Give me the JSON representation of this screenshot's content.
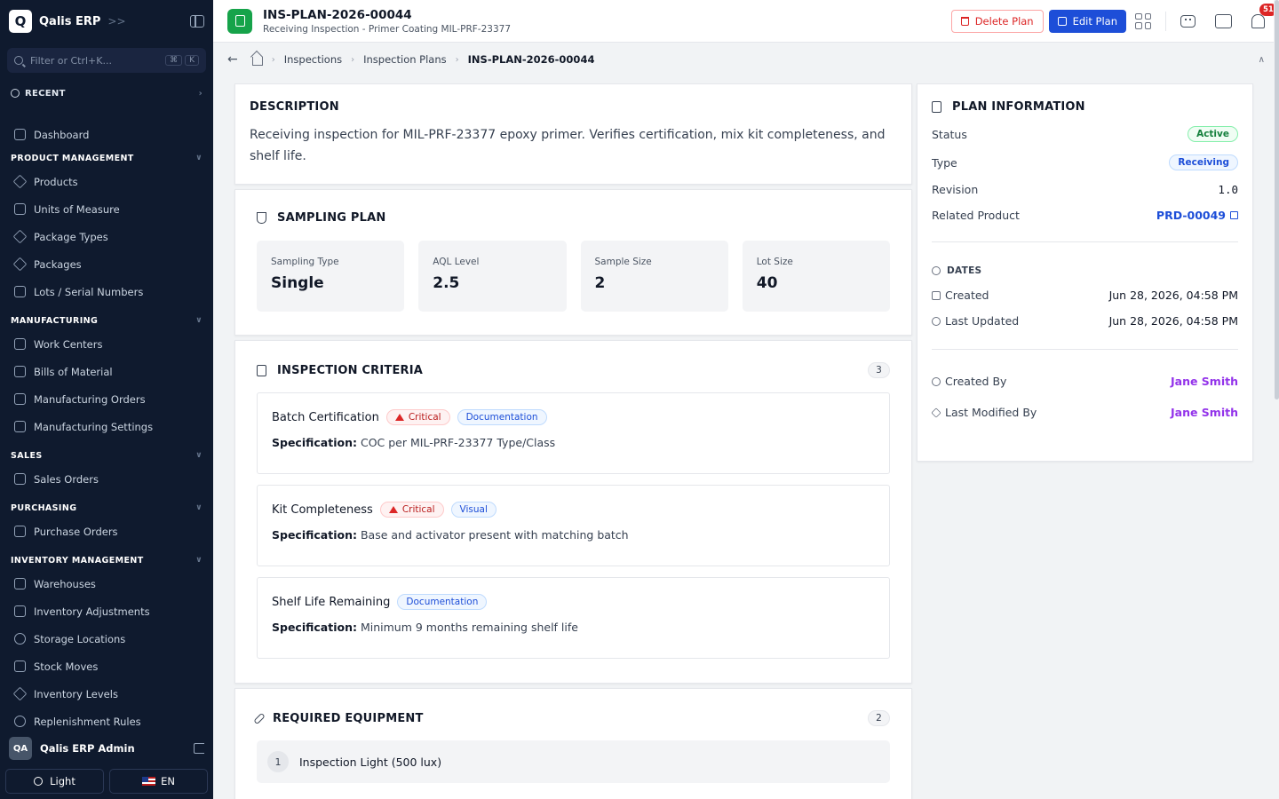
{
  "app": {
    "name": "Qalis ERP",
    "logo_letter": "Q"
  },
  "sidebar": {
    "search_placeholder": "Filter or Ctrl+K...",
    "shortcut_keys": [
      "⌘",
      "K"
    ],
    "recent_label": "RECENT",
    "dashboard": "Dashboard",
    "sections": [
      {
        "title": "PRODUCT MANAGEMENT",
        "items": [
          "Products",
          "Units of Measure",
          "Package Types",
          "Packages",
          "Lots / Serial Numbers"
        ]
      },
      {
        "title": "MANUFACTURING",
        "items": [
          "Work Centers",
          "Bills of Material",
          "Manufacturing Orders",
          "Manufacturing Settings"
        ]
      },
      {
        "title": "SALES",
        "items": [
          "Sales Orders"
        ]
      },
      {
        "title": "PURCHASING",
        "items": [
          "Purchase Orders"
        ]
      },
      {
        "title": "INVENTORY MANAGEMENT",
        "items": [
          "Warehouses",
          "Inventory Adjustments",
          "Storage Locations",
          "Stock Moves",
          "Inventory Levels",
          "Replenishment Rules"
        ]
      }
    ],
    "user": {
      "initials": "QA",
      "name": "Qalis ERP Admin"
    },
    "theme_label": "Light",
    "lang_label": "EN"
  },
  "header": {
    "title": "INS-PLAN-2026-00044",
    "subtitle": "Receiving Inspection - Primer Coating MIL-PRF-23377",
    "delete_label": "Delete Plan",
    "edit_label": "Edit Plan",
    "notification_count": "51"
  },
  "breadcrumb": [
    "Inspections",
    "Inspection Plans",
    "INS-PLAN-2026-00044"
  ],
  "description": {
    "title": "DESCRIPTION",
    "text": "Receiving inspection for MIL-PRF-23377 epoxy primer. Verifies certification, mix kit completeness, and shelf life."
  },
  "sampling": {
    "title": "SAMPLING PLAN",
    "metrics": [
      {
        "label": "Sampling Type",
        "value": "Single"
      },
      {
        "label": "AQL Level",
        "value": "2.5"
      },
      {
        "label": "Sample Size",
        "value": "2"
      },
      {
        "label": "Lot Size",
        "value": "40"
      }
    ]
  },
  "criteria": {
    "title": "INSPECTION CRITERIA",
    "count": "3",
    "spec_label": "Specification:",
    "items": [
      {
        "name": "Batch Certification",
        "critical": "Critical",
        "category": "Documentation",
        "spec": "COC per MIL-PRF-23377 Type/Class"
      },
      {
        "name": "Kit Completeness",
        "critical": "Critical",
        "category": "Visual",
        "spec": "Base and activator present with matching batch"
      },
      {
        "name": "Shelf Life Remaining",
        "category": "Documentation",
        "spec": "Minimum 9 months remaining shelf life"
      }
    ]
  },
  "equipment": {
    "title": "REQUIRED EQUIPMENT",
    "count": "2",
    "items": [
      {
        "num": "1",
        "name": "Inspection Light (500 lux)"
      }
    ]
  },
  "plan_info": {
    "title": "PLAN INFORMATION",
    "status_label": "Status",
    "status": "Active",
    "type_label": "Type",
    "type": "Receiving",
    "revision_label": "Revision",
    "revision": "1.0",
    "product_label": "Related Product",
    "product": "PRD-00049",
    "dates_title": "DATES",
    "created_label": "Created",
    "created": "Jun 28, 2026, 04:58 PM",
    "updated_label": "Last Updated",
    "updated": "Jun 28, 2026, 04:58 PM",
    "created_by_label": "Created By",
    "created_by": "Jane Smith",
    "modified_by_label": "Last Modified By",
    "modified_by": "Jane Smith"
  }
}
